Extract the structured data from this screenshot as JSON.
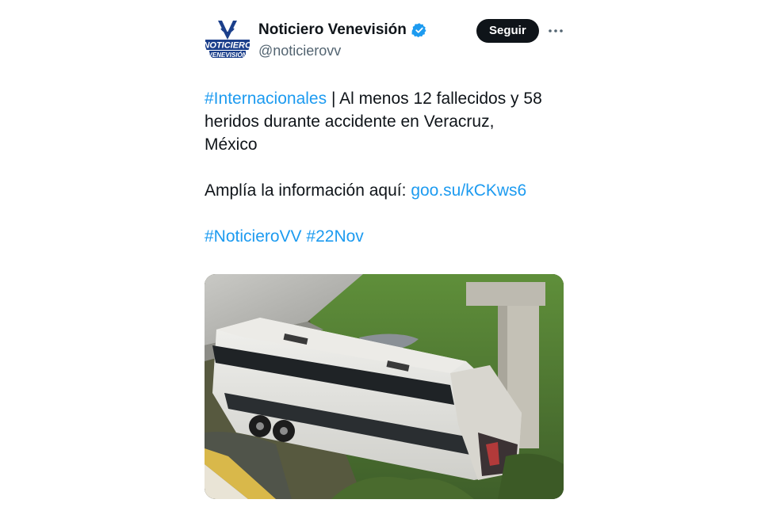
{
  "tweet": {
    "author": {
      "display_name": "Noticiero Venevisión",
      "handle": "@noticierovv",
      "avatar_icon": "noticiero-venevision-logo-icon",
      "verified_icon": "verified-badge-icon",
      "verified_color": "#1d9bf0"
    },
    "follow_label": "Seguir",
    "more_icon": "more-options-icon",
    "body": {
      "hashtag_internacionales": "#Internacionales",
      "separator": "|",
      "headline": "Al menos 12 fallecidos y 58",
      "headline_line2": "heridos durante accidente en Veracruz,",
      "headline_line3": "México",
      "more_info_label": "Amplía la información aquí:",
      "link": "goo.su/kCKws6",
      "hashtag_noticiero": "#NoticieroVV",
      "hashtag_date": "#22Nov"
    },
    "media": {
      "description_icon": "crashed-bus-photo"
    },
    "colors": {
      "link": "#1d9bf0",
      "text": "#0f1419",
      "secondary": "#536471",
      "follow_bg": "#0f1419"
    }
  }
}
